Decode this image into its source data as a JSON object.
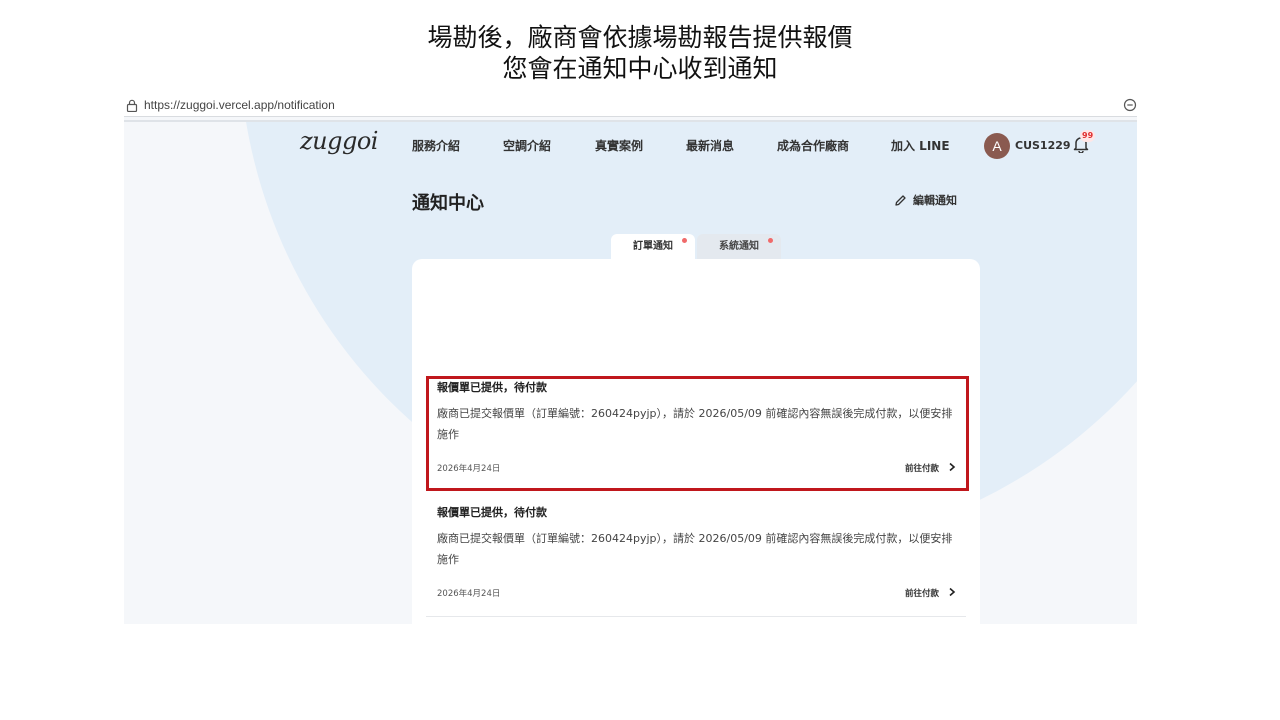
{
  "caption": {
    "line1": "場勘後，廠商會依據場勘報告提供報價",
    "line2": "您會在通知中心收到通知"
  },
  "browser": {
    "url": "https://zuggoi.vercel.app/notification",
    "lock_icon": "lock-icon",
    "zoom_icon": "zoom-out-icon"
  },
  "nav": {
    "logo": "zuggoi",
    "items": [
      "服務介紹",
      "空調介紹",
      "真實案例",
      "最新消息",
      "成為合作廠商",
      "加入 LINE"
    ],
    "avatar_initial": "A",
    "username": "CUS1229",
    "bell_badge": "99"
  },
  "page": {
    "title": "通知中心",
    "edit_label": "編輯通知"
  },
  "tabs": [
    {
      "label": "訂單通知",
      "active": true,
      "has_dot": true
    },
    {
      "label": "系統通知",
      "active": false,
      "has_dot": true
    }
  ],
  "notifications": [
    {
      "title": "報價單已提供，待付款",
      "body": "廠商已提交報價單（訂單編號：260424pyjp），請於 2026/05/09 前確認內容無誤後完成付款，以便安排施作",
      "date": "2026年4月24日",
      "link": "前往付款"
    },
    {
      "title": "報價單已提供，待付款",
      "body": "廠商已提交報價單（訂單編號：260424pyjp），請於 2026/05/09 前確認內容無誤後完成付款，以便安排施作",
      "date": "2026年4月24日",
      "link": "前往付款"
    }
  ],
  "colors": {
    "highlight": "#c0171c",
    "background_circle": "#e3eef8",
    "avatar": "#8a5a50",
    "tab_dot": "#f06a6a"
  }
}
